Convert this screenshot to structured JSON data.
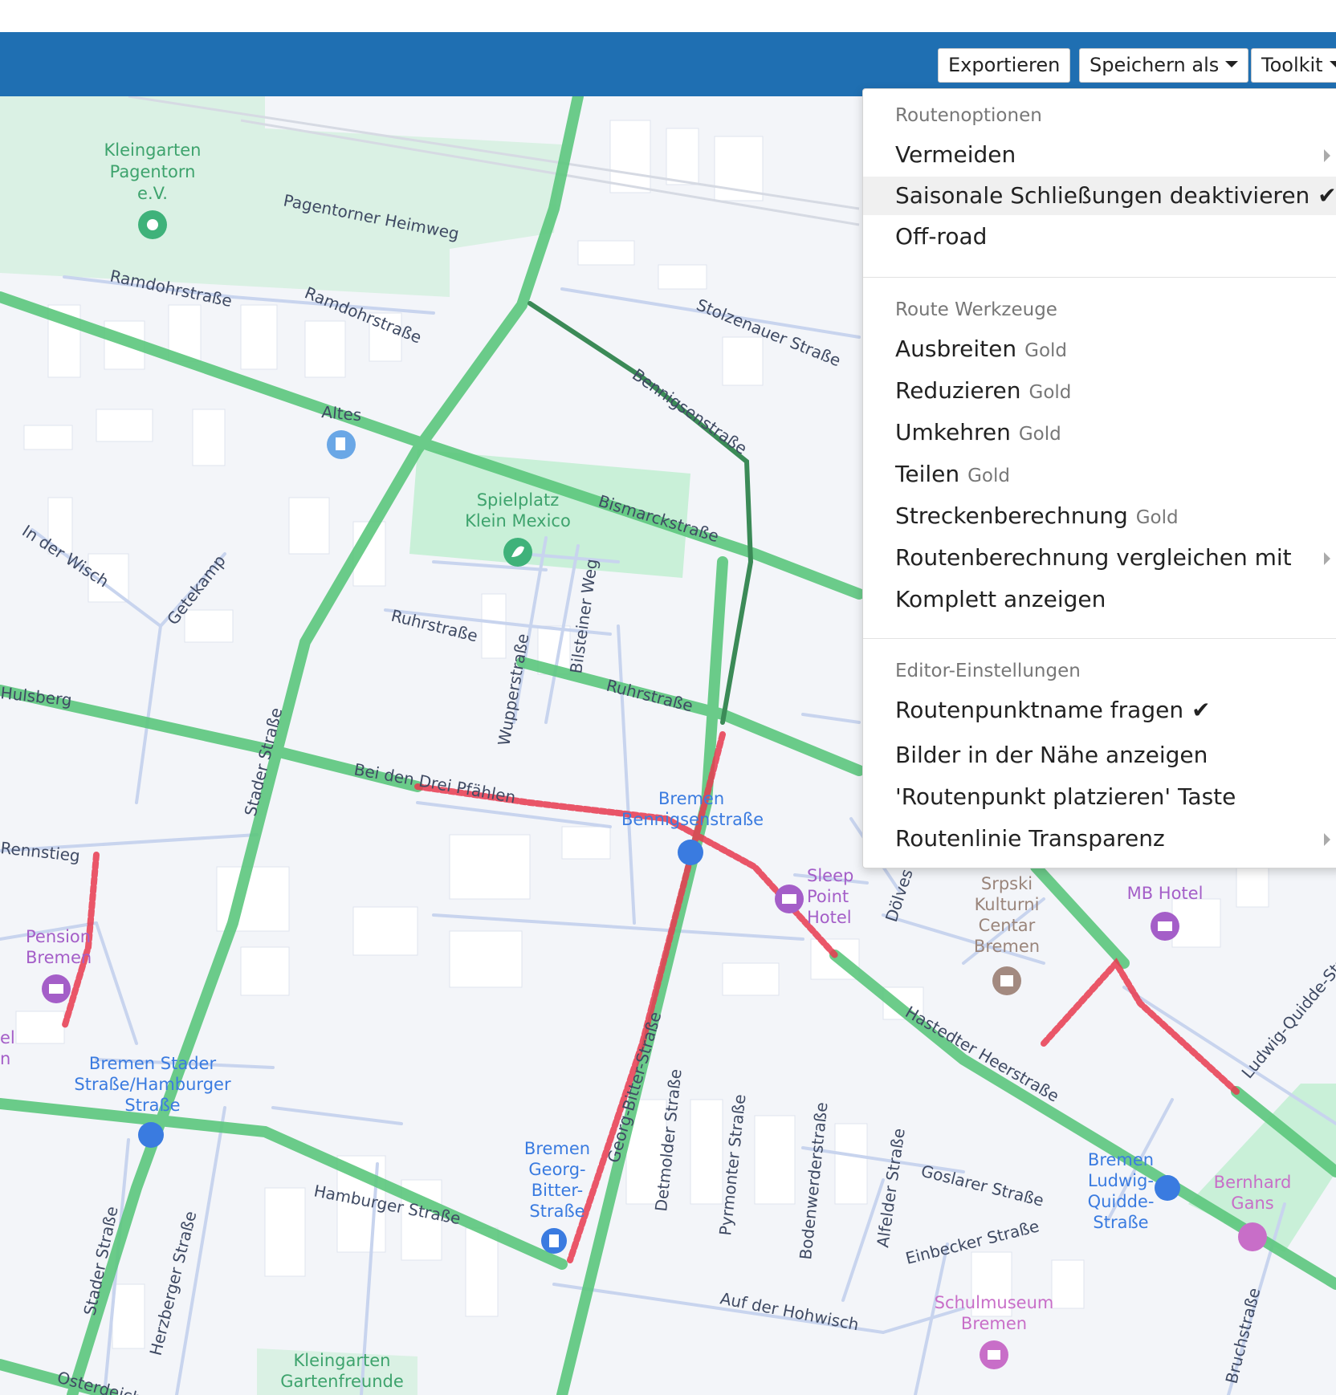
{
  "toolbar": {
    "export_label": "Exportieren",
    "save_as_label": "Speichern als",
    "toolkit_label": "Toolkit"
  },
  "menu": {
    "route_options": {
      "header": "Routenoptionen",
      "items": [
        {
          "label": "Vermeiden",
          "submenu": true
        },
        {
          "label": "Saisonale Schließungen deaktivieren",
          "checked": true,
          "check": "✔"
        },
        {
          "label": "Off-road"
        }
      ]
    },
    "route_tools": {
      "header": "Route Werkzeuge",
      "items": [
        {
          "label": "Ausbreiten",
          "badge": "Gold"
        },
        {
          "label": "Reduzieren",
          "badge": "Gold"
        },
        {
          "label": "Umkehren",
          "badge": "Gold"
        },
        {
          "label": "Teilen",
          "badge": "Gold"
        },
        {
          "label": "Streckenberechnung",
          "badge": "Gold"
        },
        {
          "label": "Routenberechnung vergleichen mit",
          "submenu": true
        },
        {
          "label": "Komplett anzeigen"
        }
      ]
    },
    "editor_settings": {
      "header": "Editor-Einstellungen",
      "items": [
        {
          "label": "Routenpunktname fragen",
          "checked": true,
          "check": "✔"
        },
        {
          "label": "Bilder in der Nähe anzeigen"
        },
        {
          "label": "'Routenpunkt platzieren' Taste"
        },
        {
          "label": "Routenlinie Transparenz",
          "submenu": true
        }
      ]
    }
  },
  "map": {
    "colors": {
      "background": "#f3f5f9",
      "park": "#daf1e4",
      "bike_route": "#5cc77d",
      "unpaved": "#e83a4f",
      "toolbar": "#1f6fb2"
    },
    "road_labels": {
      "pagentorner": "Pagentorner Heimweg",
      "ramdohr1": "Ramdohrstraße",
      "ramdohr2": "Ramdohrstraße",
      "stolzenauer": "Stolzenauer Straße",
      "in_der_wisch": "In der Wisch",
      "getekamp": "Getekamp",
      "ruhr1": "Ruhrstraße",
      "ruhr2": "Ruhrstraße",
      "wupper": "Wupperstraße",
      "bilsteiner": "Bilsteiner Weg",
      "bismarck": "Bismarckstraße",
      "bennigsen": "Bennigsenstraße",
      "rennstieg": "Rennstieg",
      "hulsberg": "Hulsberg",
      "beiden_pfaehlen": "Bei den Drei Pfählen",
      "stader": "Stader Straße",
      "hamburger": "Hamburger Straße",
      "georg_bitter": "Georg-Bitter-Straße",
      "detmolder": "Detmolder Straße",
      "pyrmonter": "Pyrmonter Straße",
      "bodenwerder": "Bodenwerderstraße",
      "alfelder": "Alfelder Straße",
      "goslarer": "Goslarer Straße",
      "einbecker": "Einbecker Straße",
      "hohwisch": "Auf der Hohwisch",
      "herzberger": "Herzberger Straße",
      "stader2": "Stader Straße",
      "hastedter": "Hastedter Heerstraße",
      "ludwig": "Ludwig-Quidde-Str",
      "doelves": "Dölves",
      "bruch": "Bruchstraße",
      "ostertor": "Osterdeich",
      "altes": "Altes"
    },
    "pois": {
      "kleingarten_pagentorn": [
        "Kleingarten",
        "Pagentorn",
        "e.V."
      ],
      "spielplatz": [
        "Spielplatz",
        "Klein Mexico"
      ],
      "pension": [
        "Pension",
        "Bremen"
      ],
      "stop_stader": [
        "Bremen Stader",
        "Straße/Hamburger",
        "Straße"
      ],
      "stop_bennigsen": [
        "Bremen",
        "Bennigsenstraße"
      ],
      "sleep_point": [
        "Sleep",
        "Point",
        "Hotel"
      ],
      "srpski": [
        "Srpski",
        "Kulturni",
        "Centar",
        "Bremen"
      ],
      "mb_hotel": [
        "MB Hotel"
      ],
      "stop_georg": [
        "Bremen",
        "Georg-",
        "Bitter-",
        "Straße"
      ],
      "stop_ludwig": [
        "Bremen",
        "Ludwig-",
        "Quidde-",
        "Straße"
      ],
      "bernhard": [
        "Bernhard",
        "Gans"
      ],
      "schulmuseum": [
        "Schulmuseum",
        "Bremen"
      ],
      "kleingarten_gartenfreunde": [
        "Kleingarten",
        "Gartenfreunde"
      ],
      "el_partial": [
        "el",
        "n"
      ]
    }
  }
}
